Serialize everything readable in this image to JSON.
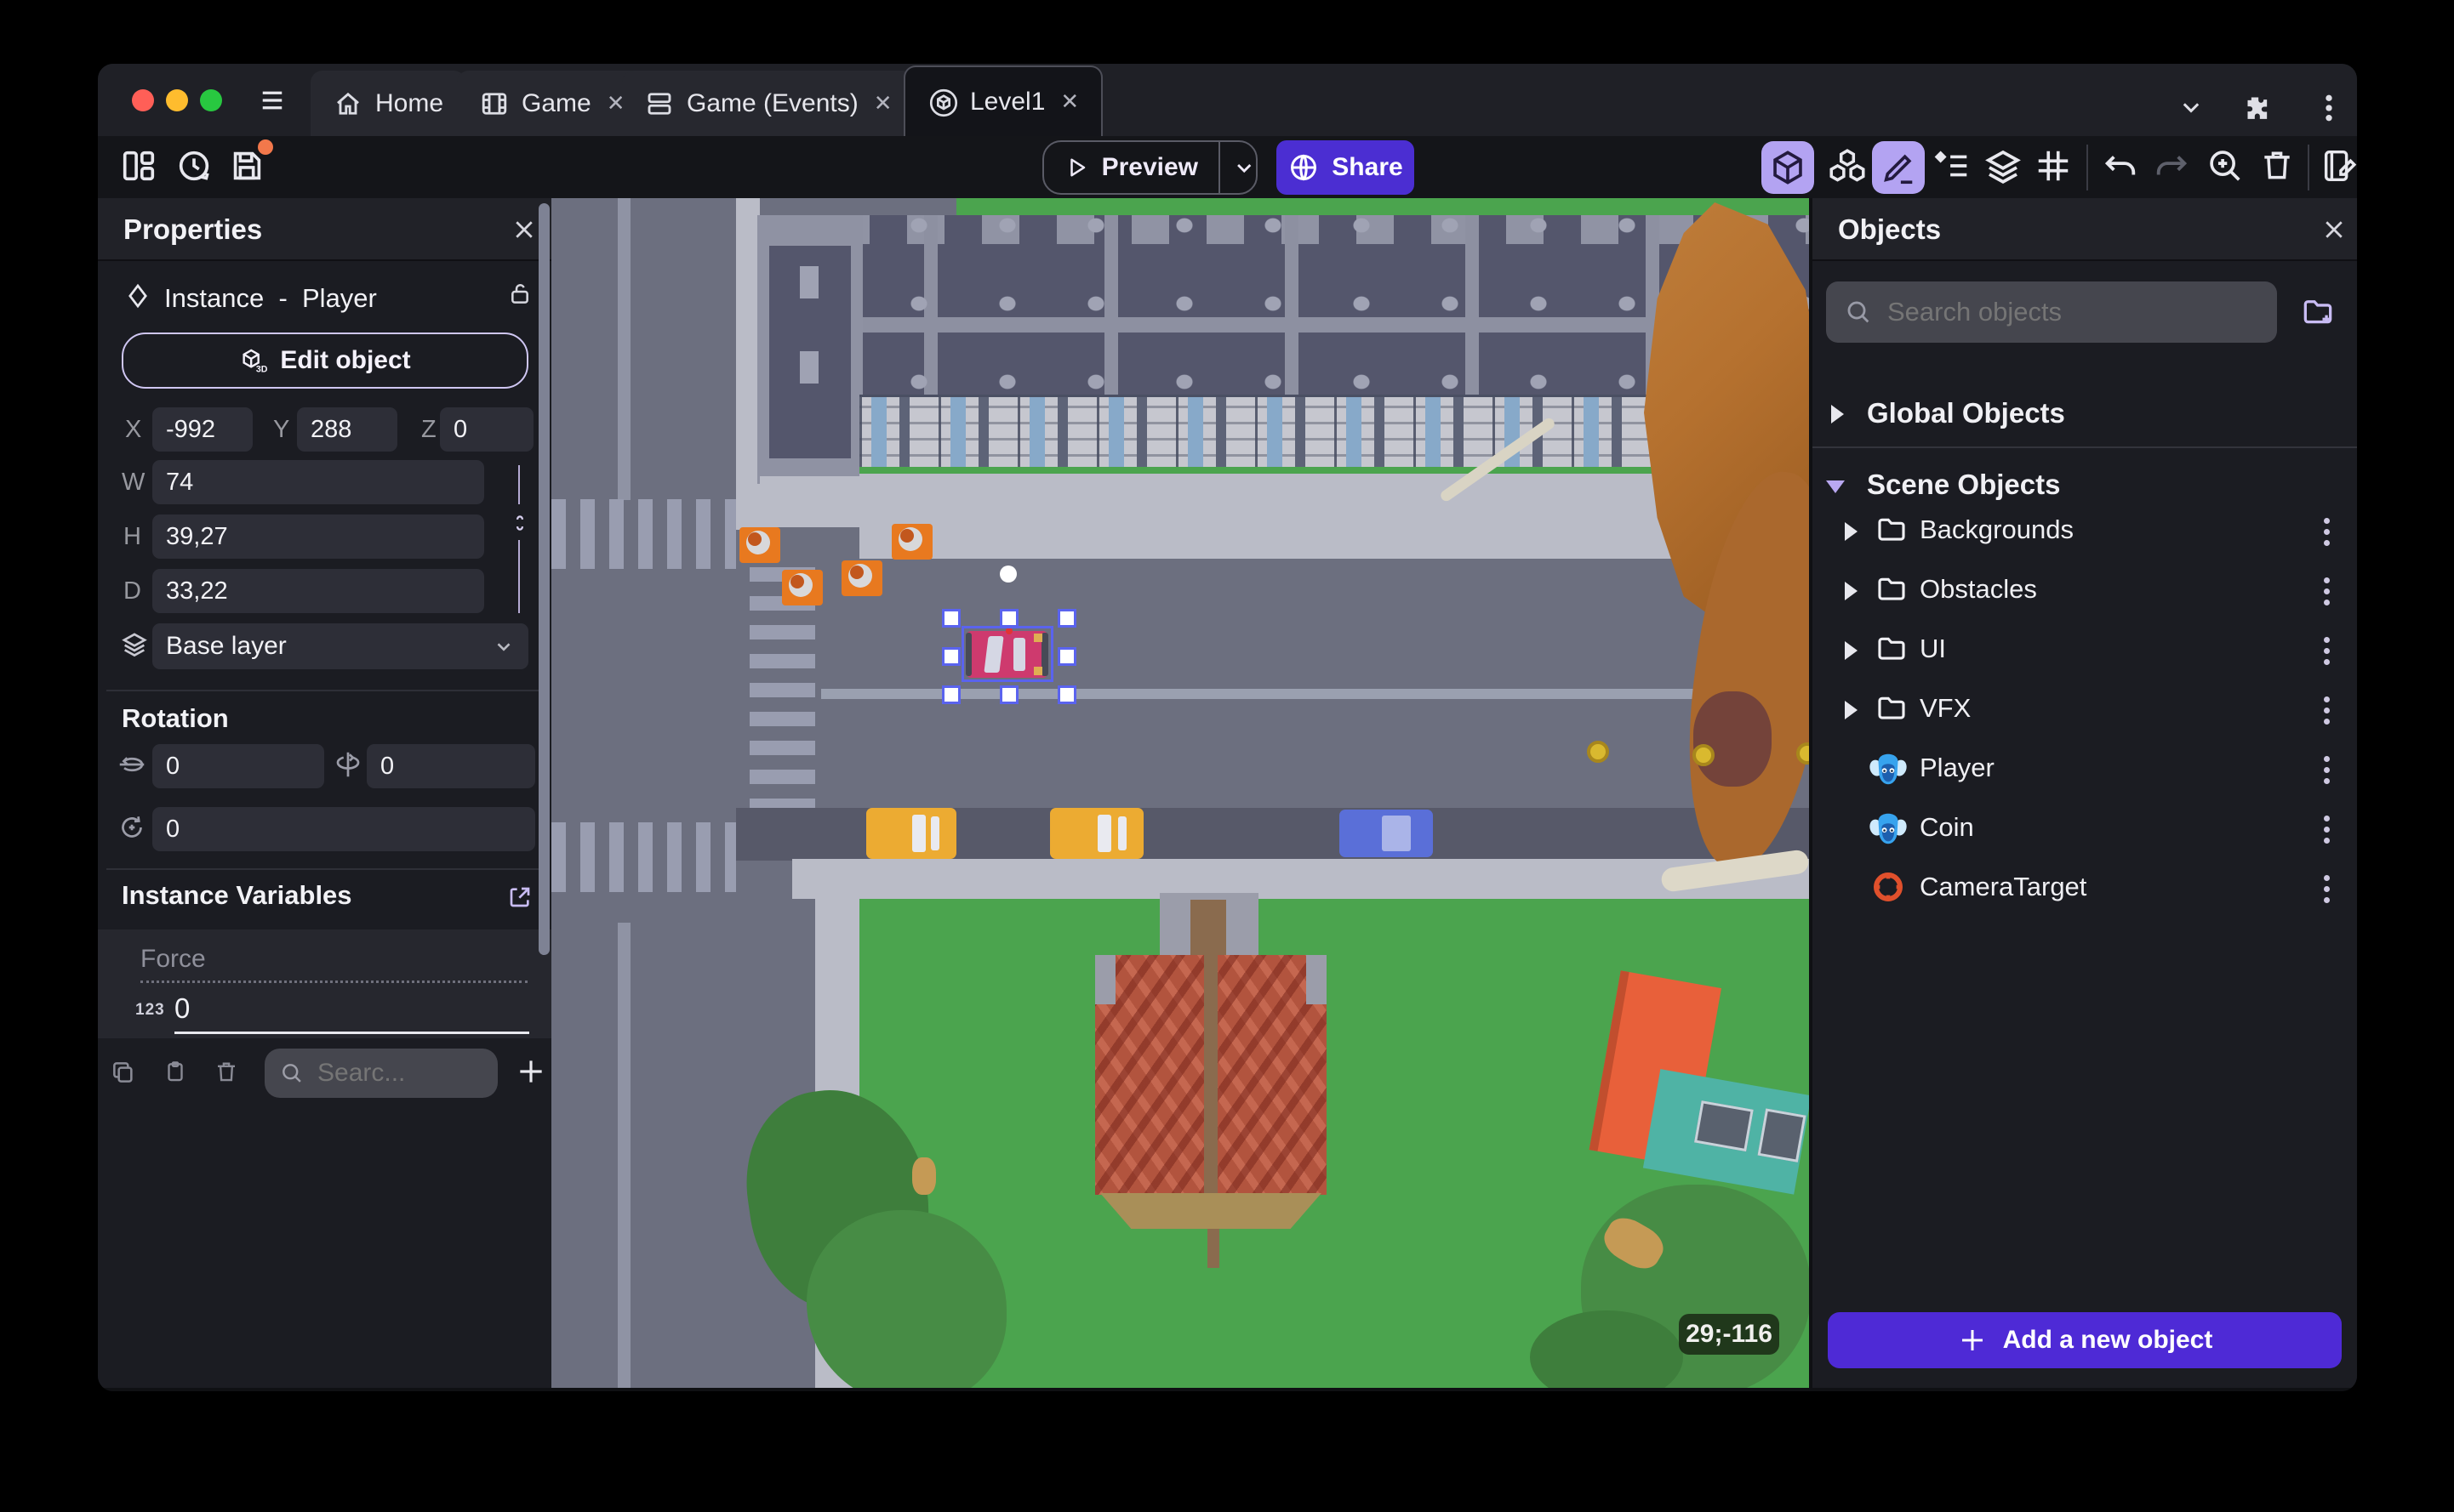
{
  "titlebar": {
    "tabs": [
      {
        "label": "Home"
      },
      {
        "label": "Game"
      },
      {
        "label": "Game (Events)"
      },
      {
        "label": "Level1"
      }
    ]
  },
  "toolbar": {
    "preview": "Preview",
    "share": "Share"
  },
  "properties": {
    "title": "Properties",
    "instance_type": "Instance",
    "separator": "-",
    "instance_name": "Player",
    "edit_object": "Edit object",
    "x_label": "X",
    "x": "-992",
    "y_label": "Y",
    "y": "288",
    "z_label": "Z",
    "z": "0",
    "w_label": "W",
    "w": "74",
    "h_label": "H",
    "h": "39,27",
    "d_label": "D",
    "d": "33,22",
    "layer": "Base layer",
    "rotation_title": "Rotation",
    "rot_x": "0",
    "rot_y": "0",
    "rot_z": "0",
    "variables_title": "Instance Variables",
    "variable": {
      "name": "Force",
      "type": "123",
      "value": "0"
    },
    "search_placeholder": "Searc..."
  },
  "objects": {
    "title": "Objects",
    "search_placeholder": "Search objects",
    "global_label": "Global Objects",
    "scene_label": "Scene Objects",
    "tree": [
      {
        "label": "Backgrounds",
        "kind": "folder"
      },
      {
        "label": "Obstacles",
        "kind": "folder"
      },
      {
        "label": "UI",
        "kind": "folder"
      },
      {
        "label": "VFX",
        "kind": "folder"
      },
      {
        "label": "Player",
        "kind": "object"
      },
      {
        "label": "Coin",
        "kind": "object"
      },
      {
        "label": "CameraTarget",
        "kind": "camera"
      }
    ],
    "add_button": "Add a new object"
  },
  "canvas": {
    "coords": "29;-116"
  },
  "colors": {
    "accent_purple": "#4b2ed2",
    "active_tool_bg": "#b3a3f2",
    "selection_blue": "#5a63ee",
    "cone_orange": "#e8791f",
    "grass_green": "#4ba44e",
    "road_gray": "#6c6f7f",
    "brick_red": "#b2543e",
    "traffic_red": "#ff5f57",
    "traffic_yellow": "#febc2e",
    "traffic_green": "#28c840"
  }
}
